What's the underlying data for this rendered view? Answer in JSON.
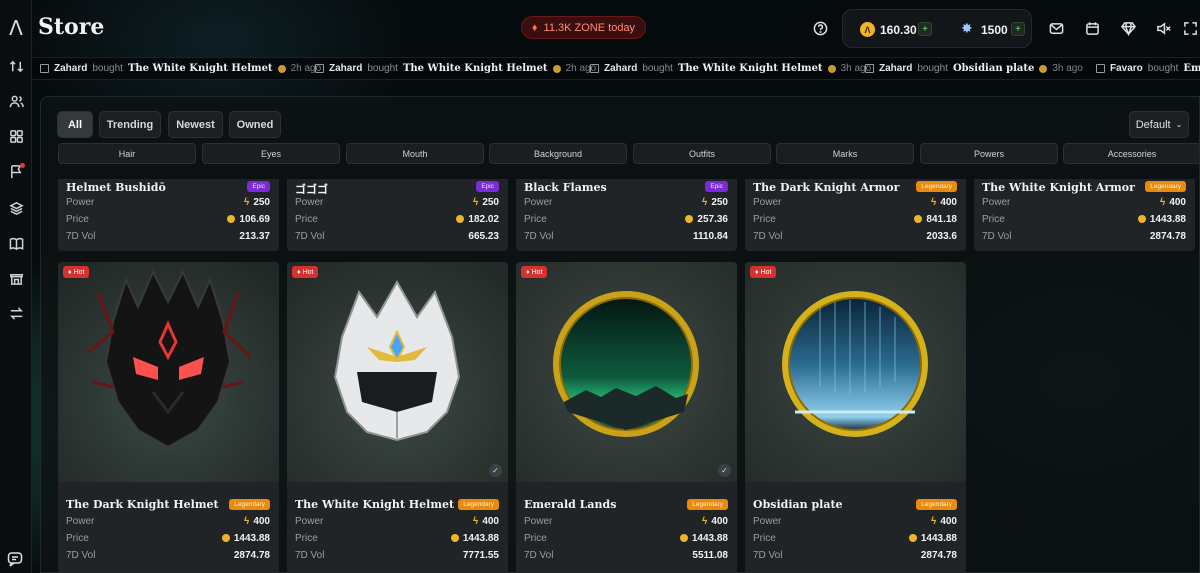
{
  "header": {
    "title": "Store",
    "zone_pill": "11.3K ZONE today",
    "zone_balance": "160.30",
    "gem_balance": "1500"
  },
  "ticker": [
    {
      "user": "Zahard",
      "verb": "bought",
      "item": "The White Knight Helmet",
      "ago": "2h ago"
    },
    {
      "user": "Zahard",
      "verb": "bought",
      "item": "The White Knight Helmet",
      "ago": "2h ago"
    },
    {
      "user": "Zahard",
      "verb": "bought",
      "item": "The White Knight Helmet",
      "ago": "3h ago"
    },
    {
      "user": "Zahard",
      "verb": "bought",
      "item": "Obsidian plate",
      "ago": "3h ago"
    },
    {
      "user": "Favaro",
      "verb": "bought",
      "item": "Emera",
      "ago": ""
    }
  ],
  "tabs": [
    "All",
    "Trending",
    "Newest",
    "Owned"
  ],
  "sort_label": "Default",
  "categories": [
    "Hair",
    "Eyes",
    "Mouth",
    "Background",
    "Outfits",
    "Marks",
    "Powers",
    "Accessories"
  ],
  "labels": {
    "power": "Power",
    "price": "Price",
    "vol": "7D Vol",
    "hot": "Hot"
  },
  "top_cards": [
    {
      "name": "Helmet Bushidō",
      "rarity": "Epic",
      "power": "250",
      "price": "106.69",
      "vol": "213.37"
    },
    {
      "name": "ゴゴゴ",
      "rarity": "Epic",
      "power": "250",
      "price": "182.02",
      "vol": "665.23"
    },
    {
      "name": "Black Flames",
      "rarity": "Epic",
      "power": "250",
      "price": "257.36",
      "vol": "1110.84"
    },
    {
      "name": "The Dark Knight Armor",
      "rarity": "Legendary",
      "power": "400",
      "price": "841.18",
      "vol": "2033.6"
    },
    {
      "name": "The White Knight Armor",
      "rarity": "Legendary",
      "power": "400",
      "price": "1443.88",
      "vol": "2874.78"
    }
  ],
  "bottom_cards": [
    {
      "name": "The Dark Knight Helmet",
      "rarity": "Legendary",
      "power": "400",
      "price": "1443.88",
      "vol": "2874.78",
      "art": "dark-helmet"
    },
    {
      "name": "The White Knight Helmet",
      "rarity": "Legendary",
      "power": "400",
      "price": "1443.88",
      "vol": "7771.55",
      "art": "white-helmet"
    },
    {
      "name": "Emerald Lands",
      "rarity": "Legendary",
      "power": "400",
      "price": "1443.88",
      "vol": "5511.08",
      "art": "emerald-orb"
    },
    {
      "name": "Obsidian plate",
      "rarity": "Legendary",
      "power": "400",
      "price": "1443.88",
      "vol": "2874.78",
      "art": "obsidian-orb"
    }
  ],
  "colors": {
    "epic": "#7a2bd6",
    "legendary": "#e88a0c",
    "hot": "#d6312e",
    "coin": "#f0b429"
  }
}
